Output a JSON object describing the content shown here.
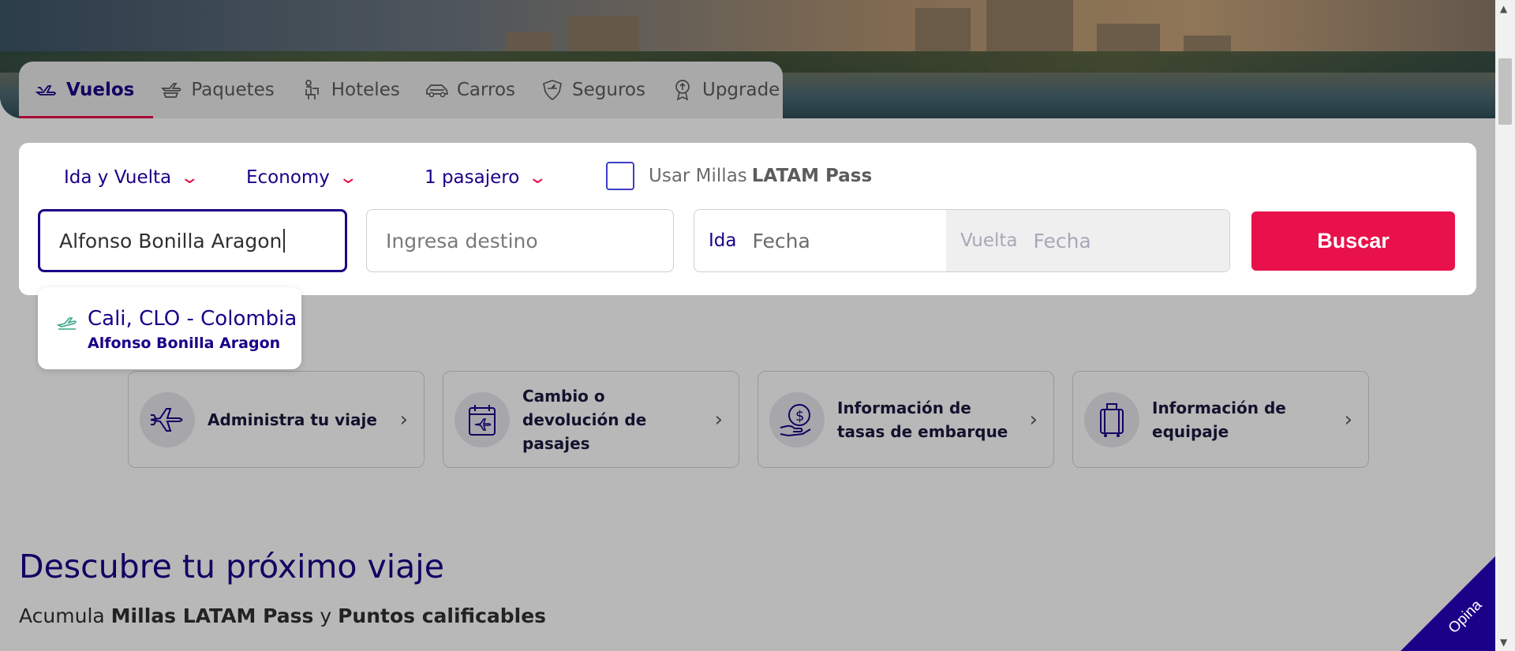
{
  "tabs": [
    {
      "label": "Vuelos",
      "icon": "plane-icon",
      "active": true
    },
    {
      "label": "Paquetes",
      "icon": "package-plane-icon",
      "active": false
    },
    {
      "label": "Hoteles",
      "icon": "hotel-bellhop-icon",
      "active": false
    },
    {
      "label": "Carros",
      "icon": "car-icon",
      "active": false
    },
    {
      "label": "Seguros",
      "icon": "shield-icon",
      "active": false
    },
    {
      "label": "Upgrade",
      "icon": "upgrade-badge-icon",
      "active": false
    }
  ],
  "search": {
    "trip_type": "Ida y Vuelta",
    "cabin": "Economy",
    "passengers": "1 pasajero",
    "miles_label_prefix": "Usar Millas",
    "miles_label_bold": "LATAM Pass",
    "origin_value": "Alfonso Bonilla Aragon",
    "destination_placeholder": "Ingresa destino",
    "ida_label": "Ida",
    "ida_value": "Fecha",
    "vuelta_label": "Vuelta",
    "vuelta_value": "Fecha",
    "search_button": "Buscar"
  },
  "suggestion": {
    "title": "Cali, CLO - Colombia",
    "subtitle": "Alfonso Bonilla Aragon"
  },
  "quick_links": [
    {
      "label": "Administra tu viaje",
      "icon": "airplane-icon"
    },
    {
      "label": "Cambio o devolución de pasajes",
      "icon": "calendar-plane-icon"
    },
    {
      "label": "Información de tasas de embarque",
      "icon": "money-hand-icon"
    },
    {
      "label": "Información de equipaje",
      "icon": "luggage-icon"
    }
  ],
  "discover": {
    "title": "Descubre tu próximo viaje",
    "sub_prefix": "Acumula",
    "sub_bold1": "Millas LATAM Pass",
    "sub_mid": "y",
    "sub_bold2": "Puntos calificables"
  },
  "feedback": {
    "label": "Opina"
  },
  "colors": {
    "brand": "#1b0088",
    "accent": "#e8114b"
  }
}
